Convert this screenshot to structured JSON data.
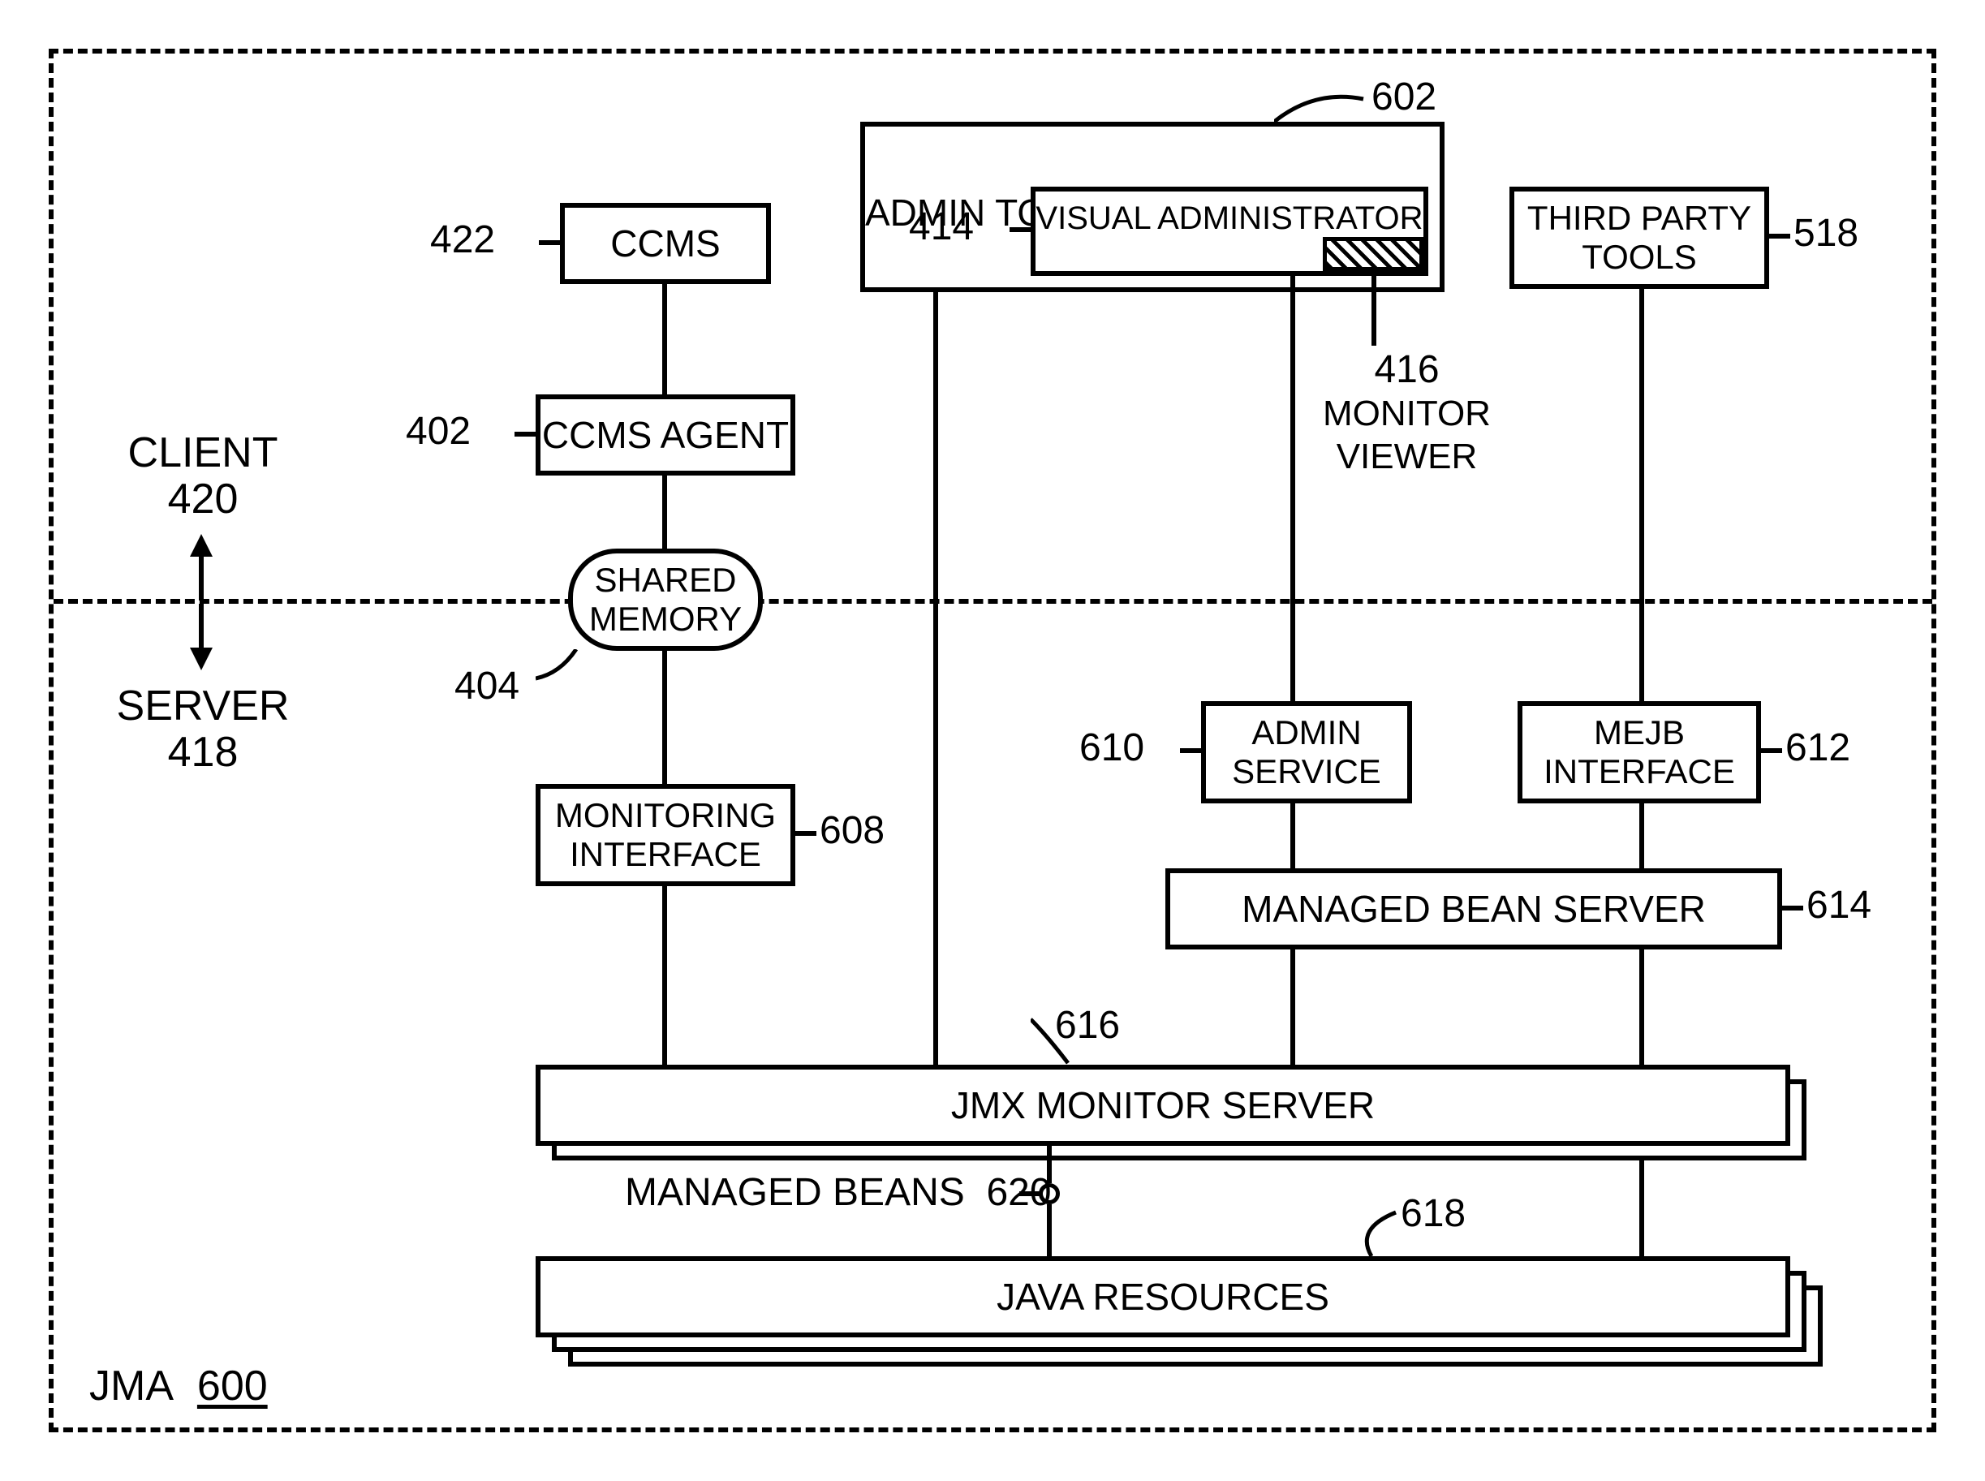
{
  "regions": {
    "client_label": "CLIENT",
    "client_num": "420",
    "server_label": "SERVER",
    "server_num": "418",
    "jma_label": "JMA",
    "jma_num": "600"
  },
  "nodes": {
    "ccms": {
      "label": "CCMS",
      "ref": "422"
    },
    "ccms_agent": {
      "label": "CCMS AGENT",
      "ref": "402"
    },
    "shared_memory": {
      "label": "SHARED\nMEMORY",
      "ref": "404"
    },
    "monitoring_interface": {
      "label": "MONITORING\nINTERFACE",
      "ref": "608"
    },
    "admin_tools": {
      "label": "ADMIN TOOLS",
      "ref": "602"
    },
    "visual_admin": {
      "label": "VISUAL ADMINISTRATOR",
      "ref": "414"
    },
    "monitor_viewer": {
      "label": "MONITOR\nVIEWER",
      "ref": "416"
    },
    "third_party": {
      "label": "THIRD PARTY\nTOOLS",
      "ref": "518"
    },
    "admin_service": {
      "label": "ADMIN\nSERVICE",
      "ref": "610"
    },
    "mejb_interface": {
      "label": "MEJB\nINTERFACE",
      "ref": "612"
    },
    "managed_bean_server": {
      "label": "MANAGED BEAN SERVER",
      "ref": "614"
    },
    "jmx_monitor_server": {
      "label": "JMX MONITOR SERVER",
      "ref": "616"
    },
    "managed_beans": {
      "label": "MANAGED BEANS",
      "ref": "620"
    },
    "java_resources": {
      "label": "JAVA RESOURCES",
      "ref": "618"
    }
  }
}
